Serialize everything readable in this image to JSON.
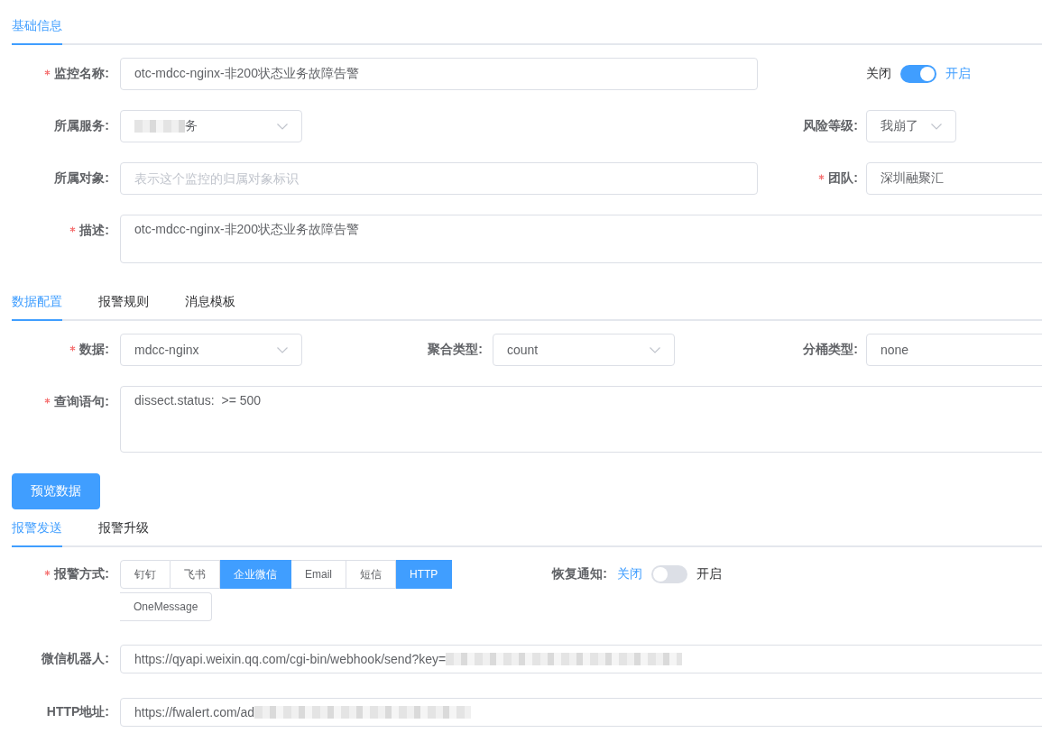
{
  "basic_tabs": [
    {
      "label": "基础信息",
      "selected": true
    }
  ],
  "basic_form": {
    "name": {
      "label": "监控名称:",
      "required": true,
      "value": "otc-mdcc-nginx-非200状态业务故障告警"
    },
    "status_switch": {
      "off_label": "关闭",
      "on_label": "开启",
      "on": true
    },
    "service": {
      "label": "所属服务:",
      "required": false,
      "value": "务",
      "redacted": true
    },
    "risk_level": {
      "label": "风险等级:",
      "required": false,
      "value": "我崩了"
    },
    "object": {
      "label": "所属对象:",
      "required": false,
      "placeholder": "表示这个监控的归属对象标识"
    },
    "team": {
      "label": "团队:",
      "required": true,
      "value": "深圳融聚汇"
    },
    "description": {
      "label": "描述:",
      "required": true,
      "value": "otc-mdcc-nginx-非200状态业务故障告警"
    }
  },
  "data_tabs": [
    {
      "label": "数据配置",
      "selected": true
    },
    {
      "label": "报警规则",
      "selected": false
    },
    {
      "label": "消息模板",
      "selected": false
    }
  ],
  "data_form": {
    "data_source": {
      "label": "数据:",
      "required": true,
      "value": "mdcc-nginx"
    },
    "aggregation": {
      "label": "聚合类型:",
      "required": false,
      "value": "count"
    },
    "bucket": {
      "label": "分桶类型:",
      "required": false,
      "value": "none"
    },
    "query": {
      "label": "查询语句:",
      "required": true,
      "value": "dissect.status:  >= 500"
    },
    "preview_button": "预览数据"
  },
  "alert_tabs": [
    {
      "label": "报警发送",
      "selected": true
    },
    {
      "label": "报警升级",
      "selected": false
    }
  ],
  "alert_form": {
    "channels": {
      "label": "报警方式:",
      "required": true,
      "options": [
        {
          "label": "钉钉",
          "selected": false
        },
        {
          "label": "飞书",
          "selected": false
        },
        {
          "label": "企业微信",
          "selected": true
        },
        {
          "label": "Email",
          "selected": false
        },
        {
          "label": "短信",
          "selected": false
        },
        {
          "label": "HTTP",
          "selected": true
        },
        {
          "label": "OneMessage",
          "selected": false
        }
      ]
    },
    "recovery": {
      "label": "恢复通知:",
      "off_label": "关闭",
      "on_label": "开启",
      "on": false
    },
    "wechat_robot": {
      "label": "微信机器人:",
      "required": false,
      "value": "https://qyapi.weixin.qq.com/cgi-bin/webhook/send?key=",
      "redacted": true
    },
    "http_url": {
      "label": "HTTP地址:",
      "required": false,
      "value": "https://fwalert.com/ad",
      "redacted": true
    }
  }
}
